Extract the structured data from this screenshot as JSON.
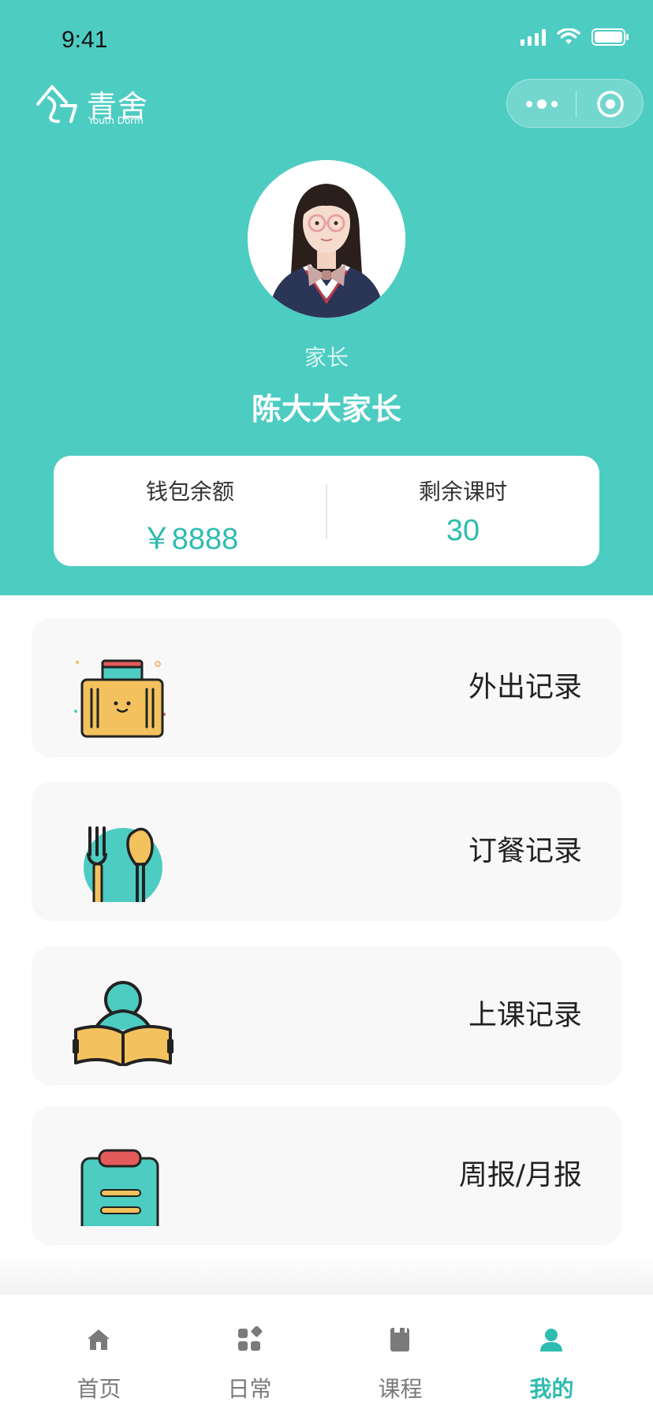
{
  "status_bar": {
    "time": "9:41"
  },
  "header": {
    "logo_text": "青舍",
    "logo_subtext": "Youth Dorm",
    "background_color": "#4dccc2",
    "role": "家长",
    "name": "陈大大家长"
  },
  "stats": {
    "wallet_label": "钱包余额",
    "wallet_value": "￥8888",
    "hours_label": "剩余课时",
    "hours_value": "30",
    "accent_color": "#2fbcb0"
  },
  "menu": [
    {
      "label": "外出记录",
      "icon": "suitcase-icon"
    },
    {
      "label": "订餐记录",
      "icon": "fork-spoon-icon"
    },
    {
      "label": "上课记录",
      "icon": "reading-book-icon"
    },
    {
      "label": "周报/月报",
      "icon": "clipboard-icon"
    }
  ],
  "tabbar": {
    "tabs": [
      {
        "label": "首页",
        "icon": "home-icon",
        "active": false
      },
      {
        "label": "日常",
        "icon": "apps-icon",
        "active": false
      },
      {
        "label": "课程",
        "icon": "book-icon",
        "active": false
      },
      {
        "label": "我的",
        "icon": "user-icon",
        "active": true
      }
    ]
  }
}
